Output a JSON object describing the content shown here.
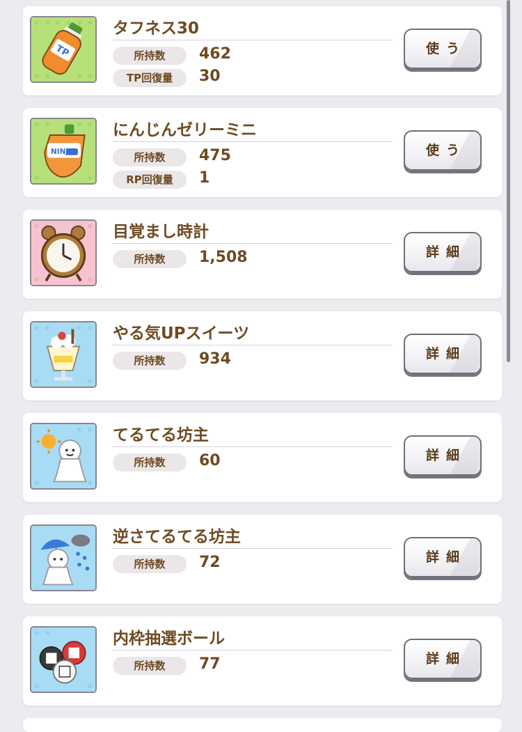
{
  "items": [
    {
      "name": "タフネス30",
      "icon": "tp-drink-bottle-icon",
      "stats": [
        {
          "label": "所持数",
          "value": "462"
        },
        {
          "label": "TP回復量",
          "value": "30"
        }
      ],
      "button": "使う"
    },
    {
      "name": "にんじんゼリーミニ",
      "icon": "carrot-jelly-pouch-icon",
      "stats": [
        {
          "label": "所持数",
          "value": "475"
        },
        {
          "label": "RP回復量",
          "value": "1"
        }
      ],
      "button": "使う"
    },
    {
      "name": "目覚まし時計",
      "icon": "alarm-clock-icon",
      "stats": [
        {
          "label": "所持数",
          "value": "1,508"
        }
      ],
      "button": "詳細"
    },
    {
      "name": "やる気UPスイーツ",
      "icon": "parfait-icon",
      "stats": [
        {
          "label": "所持数",
          "value": "934"
        }
      ],
      "button": "詳細"
    },
    {
      "name": "てるてる坊主",
      "icon": "teru-teru-bozu-sun-icon",
      "stats": [
        {
          "label": "所持数",
          "value": "60"
        }
      ],
      "button": "詳細"
    },
    {
      "name": "逆さてるてる坊主",
      "icon": "teru-teru-bozu-rain-icon",
      "stats": [
        {
          "label": "所持数",
          "value": "72"
        }
      ],
      "button": "詳細"
    },
    {
      "name": "内枠抽選ボール",
      "icon": "lottery-balls-icon",
      "stats": [
        {
          "label": "所持数",
          "value": "77"
        }
      ],
      "button": "詳細"
    }
  ],
  "colors": {
    "text": "#6e4a22",
    "background": "#ebebf0",
    "card": "#ffffff",
    "pill": "#ebe6e8"
  }
}
